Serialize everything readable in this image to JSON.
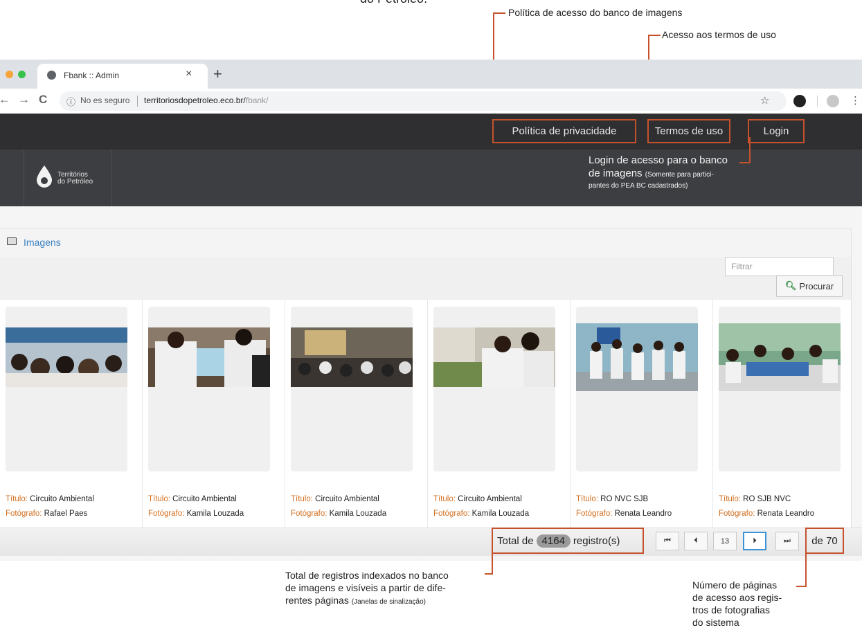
{
  "top_cut_text": "do Petróleo.",
  "annotations": {
    "privacy_policy": "Política de acesso do banco de imagens",
    "terms_access": "Acesso aos termos de uso",
    "login_line1": "Login de acesso para o banco",
    "login_line2": "de imagens",
    "login_small1": "(Somente para partici-",
    "login_small2": "pantes do PEA BC cadastrados)",
    "total_line1": "Total de registros indexados no banco",
    "total_line2": "de imagens e visíveis a partir de dife-",
    "total_line3": "rentes páginas",
    "total_small": "(Janelas de sinalização)",
    "pages_line1": "Número de páginas",
    "pages_line2": "de acesso aos regis-",
    "pages_line3": "tros de fotografias",
    "pages_line4": "do sistema"
  },
  "browser": {
    "tab_title": "Fbank :: Admin",
    "tab_close": "×",
    "new_tab": "+",
    "insecure_label": "No es seguro",
    "url_host": "territoriosdopetroleo.eco.br/",
    "url_path": "fbank/",
    "back": "←",
    "forward": "→",
    "reload": "C",
    "star": "☆",
    "menu": "⋮"
  },
  "site_nav": {
    "privacy": "Política de privacidade",
    "terms": "Termos de uso",
    "login": "Login"
  },
  "brand": {
    "line1": "Territórios",
    "line2": "do Petróleo"
  },
  "panel": {
    "title": "Imagens",
    "filter_placeholder": "Filtrar",
    "search_label": "Procurar"
  },
  "cards": [
    {
      "titulo_label": "Título:",
      "titulo": "Circuito Ambiental",
      "fotografo_label": "Fotógrafo:",
      "fotografo": "Rafael Paes"
    },
    {
      "titulo_label": "Título:",
      "titulo": "Circuito Ambiental",
      "fotografo_label": "Fotógrafo:",
      "fotografo": "Kamila Louzada"
    },
    {
      "titulo_label": "Título:",
      "titulo": "Circuito Ambiental",
      "fotografo_label": "Fotógrafo:",
      "fotografo": "Kamila Louzada"
    },
    {
      "titulo_label": "Título:",
      "titulo": "Circuito Ambiental",
      "fotografo_label": "Fotógrafo:",
      "fotografo": "Kamila Louzada"
    },
    {
      "titulo_label": "Título:",
      "titulo": "RO NVC SJB",
      "fotografo_label": "Fotógrafo:",
      "fotografo": "Renata Leandro"
    },
    {
      "titulo_label": "Título:",
      "titulo": "RO SJB NVC",
      "fotografo_label": "Fotógrafo:",
      "fotografo": "Renata Leandro"
    }
  ],
  "pager": {
    "total_prefix": "Total de",
    "total_count": "4164",
    "total_suffix": "registro(s)",
    "first": "⏮",
    "prev": "⏴",
    "current_page": "13",
    "next": "⏵",
    "last": "⏭",
    "of_pages": "de 70"
  },
  "colors": {
    "accent_orange": "#c5522c",
    "nav_dark": "#2f2f31",
    "link_blue": "#3a7fc1",
    "label_orange": "#d36e1e"
  }
}
